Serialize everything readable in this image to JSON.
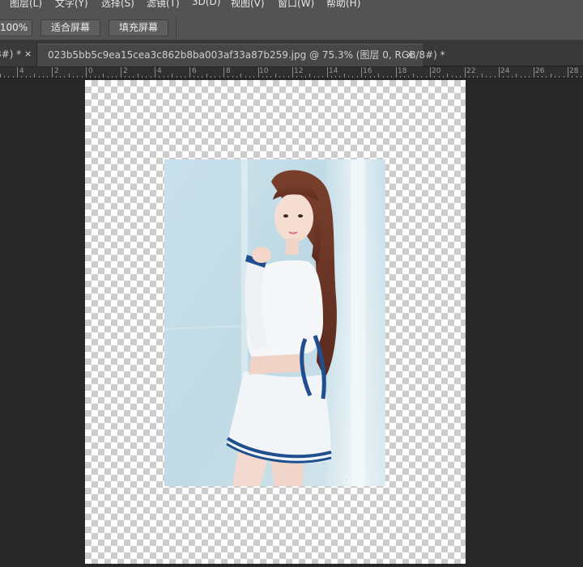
{
  "menu": {
    "items": [
      {
        "label": "图层(L)"
      },
      {
        "label": "文字(Y)"
      },
      {
        "label": "选择(S)"
      },
      {
        "label": "滤镜(T)"
      },
      {
        "label": "3D(D)"
      },
      {
        "label": "视图(V)"
      },
      {
        "label": "窗口(W)"
      },
      {
        "label": "帮助(H)"
      }
    ]
  },
  "options": {
    "zoom_label": "100%",
    "fit_screen_label": "适合屏幕",
    "fill_screen_label": "填充屏幕"
  },
  "tabs": {
    "inactive_label": "8#) *",
    "inactive_close": "×",
    "active_label": "023b5bb5c9ea15cea3c862b8ba003af33a87b259.jpg @ 75.3% (图层 0, RGB/8#) *",
    "active_close": "×"
  },
  "ruler": {
    "labels": [
      "4",
      "2",
      "0",
      "2",
      "4",
      "6",
      "8",
      "10",
      "12",
      "14",
      "16",
      "18",
      "20",
      "22",
      "24",
      "26",
      "28"
    ]
  },
  "colors": {
    "panel": "#535353",
    "tabbar": "#383838",
    "workspace": "#282828",
    "checker_light": "#ffffff",
    "checker_dark": "#cccccc"
  }
}
